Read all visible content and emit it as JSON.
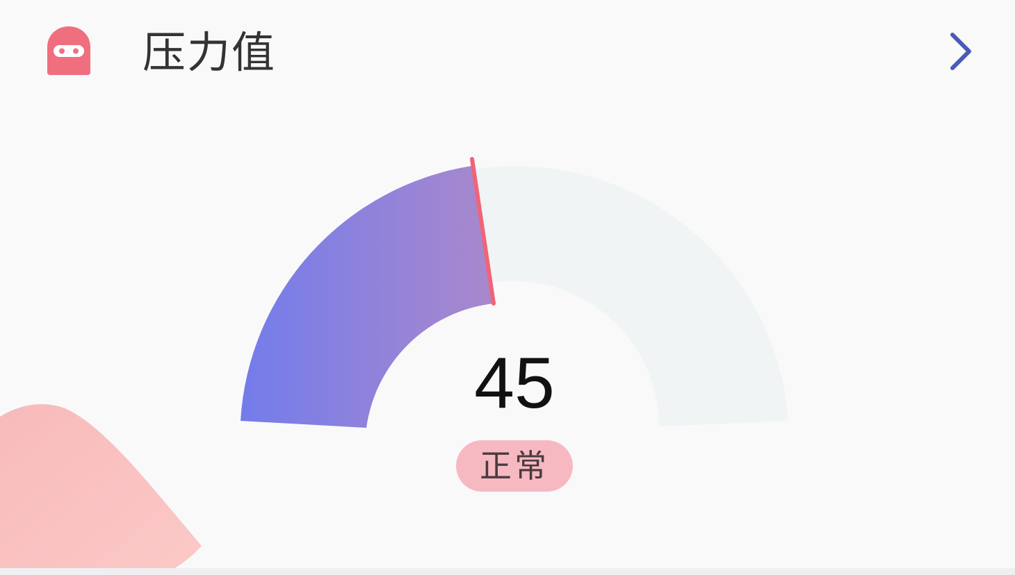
{
  "header": {
    "title": "压力值",
    "icon": "ninja-mask-icon",
    "action_icon": "chevron-right-icon"
  },
  "gauge": {
    "value": "45",
    "status": "正常",
    "progress_fraction": 0.45
  },
  "colors": {
    "icon": "#f06f7f",
    "chevron": "#4a5bb6",
    "gauge_start": "#737ceb",
    "gauge_end": "#a988cc",
    "gauge_track": "#f1f4f4",
    "needle": "#ef6479",
    "status_bg": "#f6b9c2",
    "blob": "#f8b9bb"
  }
}
